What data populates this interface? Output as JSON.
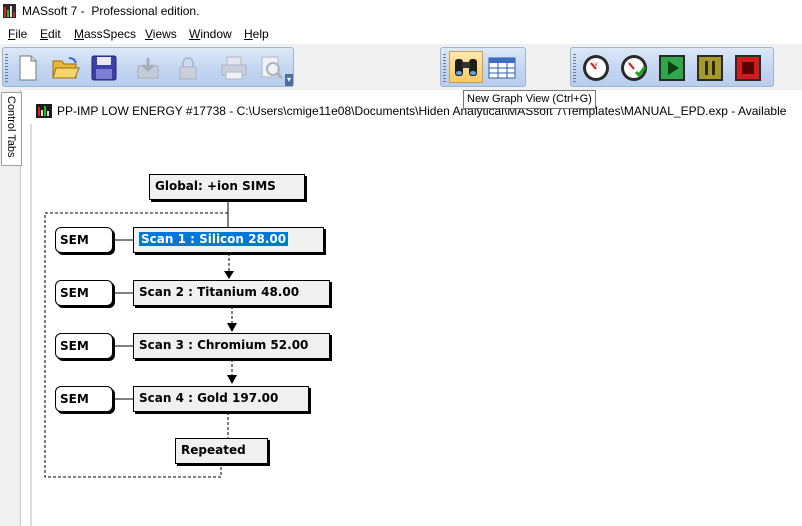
{
  "app": {
    "title": "MASsoft 7 -  Professional edition."
  },
  "menu": [
    {
      "label": "File",
      "u": "F",
      "rest": "ile"
    },
    {
      "label": "Edit",
      "u": "E",
      "rest": "dit"
    },
    {
      "label": "MassSpecs",
      "u": "M",
      "rest": "assSpecs"
    },
    {
      "label": "Views",
      "u": "V",
      "rest": "iews"
    },
    {
      "label": "Window",
      "u": "W",
      "rest": "indow"
    },
    {
      "label": "Help",
      "u": "H",
      "rest": "elp"
    }
  ],
  "toolbar": {
    "file_buttons": [
      "new-file-icon",
      "open-folder-icon",
      "save-disk-icon",
      "import-icon",
      "lock-icon",
      "print-icon",
      "print-preview-icon"
    ],
    "view_buttons": [
      "binoculars-icon",
      "table-grid-icon"
    ],
    "control_buttons": [
      "gauge-icon",
      "gauge-check-icon",
      "run-play-icon",
      "pause-icon",
      "stop-icon"
    ]
  },
  "tooltip": {
    "text": "New Graph View (Ctrl+G)"
  },
  "side_panel": {
    "tab_label": "Control Tabs"
  },
  "document": {
    "title": "PP-IMP LOW ENERGY #17738 - C:\\Users\\cmige11e08\\Documents\\Hiden Analytical\\MASsoft 7\\Templates\\MANUAL_EPD.exp - Available"
  },
  "flow": {
    "global": "Global: +ion SIMS",
    "scans": [
      {
        "detector": "SEM",
        "label": "Scan 1 : Silicon 28.00",
        "selected": true
      },
      {
        "detector": "SEM",
        "label": "Scan 2 : Titanium 48.00",
        "selected": false
      },
      {
        "detector": "SEM",
        "label": "Scan 3 : Chromium 52.00",
        "selected": false
      },
      {
        "detector": "SEM",
        "label": "Scan 4 : Gold 197.00",
        "selected": false
      }
    ],
    "repeated": "Repeated"
  },
  "colors": {
    "toolbar_blue": "#c3d6f1",
    "selection": "#0078d7",
    "box_fill": "#f0f0f0"
  }
}
